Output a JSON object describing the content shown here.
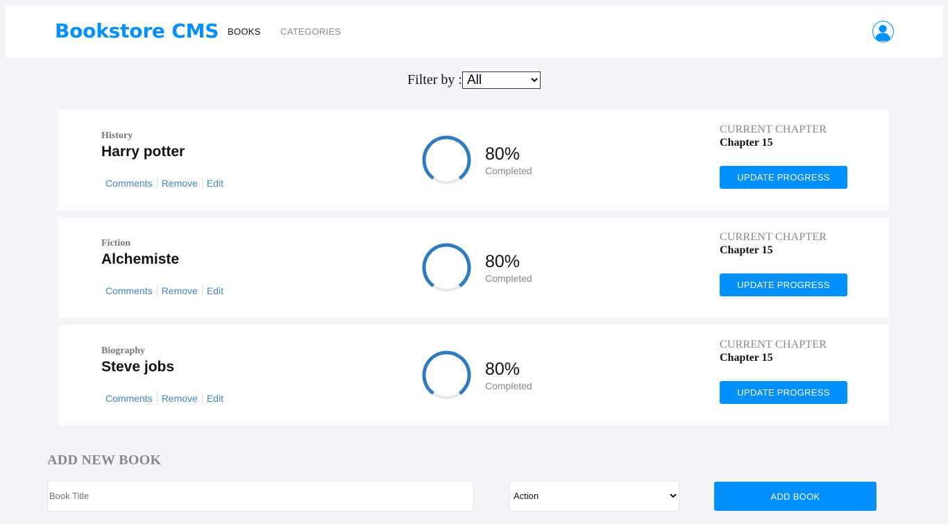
{
  "header": {
    "logo": "Bookstore CMS",
    "nav": {
      "books": "BOOKS",
      "categories": "CATEGORIES"
    },
    "avatar_icon": "user-icon"
  },
  "filter": {
    "label": "Filter by :",
    "selected": "All"
  },
  "books": [
    {
      "genre": "History",
      "title": "Harry potter",
      "progress_percent": 80,
      "percent_label": "80%",
      "completed_label": "Completed",
      "chapter_label": "CURRENT CHAPTER",
      "chapter": "Chapter 15",
      "update_label": "UPDATE PROGRESS"
    },
    {
      "genre": "Fiction",
      "title": "Alchemiste",
      "progress_percent": 80,
      "percent_label": "80%",
      "completed_label": "Completed",
      "chapter_label": "CURRENT CHAPTER",
      "chapter": "Chapter 15",
      "update_label": "UPDATE PROGRESS"
    },
    {
      "genre": "Biography",
      "title": "Steve jobs",
      "progress_percent": 80,
      "percent_label": "80%",
      "completed_label": "Completed",
      "chapter_label": "CURRENT CHAPTER",
      "chapter": "Chapter 15",
      "update_label": "UPDATE PROGRESS"
    }
  ],
  "book_actions": {
    "comments": "Comments",
    "remove": "Remove",
    "edit": "Edit"
  },
  "add_form": {
    "heading": "ADD NEW BOOK",
    "title_placeholder": "Book Title",
    "category_selected": "Action",
    "submit_label": "ADD BOOK"
  },
  "colors": {
    "accent": "#0290ff",
    "progress": "#307bbe",
    "progress_track": "#e8e8e8",
    "link": "#4386bf",
    "background": "#f3f5f9"
  }
}
